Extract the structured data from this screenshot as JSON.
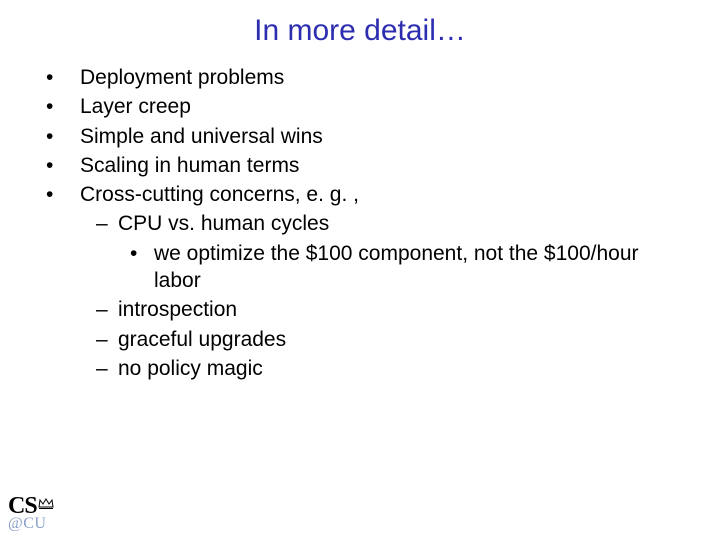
{
  "title": "In more detail…",
  "bullets": {
    "b1": "Deployment problems",
    "b2": "Layer creep",
    "b3": "Simple and universal wins",
    "b4": "Scaling in human terms",
    "b5": "Cross-cutting concerns, e. g. ,",
    "b5a": "CPU vs. human cycles",
    "b5a1": "we optimize the $100 component, not the $100/hour labor",
    "b5b": "introspection",
    "b5c": "graceful upgrades",
    "b5d": "no policy magic"
  },
  "logo": {
    "top": "CS",
    "bottom": "@CU"
  }
}
